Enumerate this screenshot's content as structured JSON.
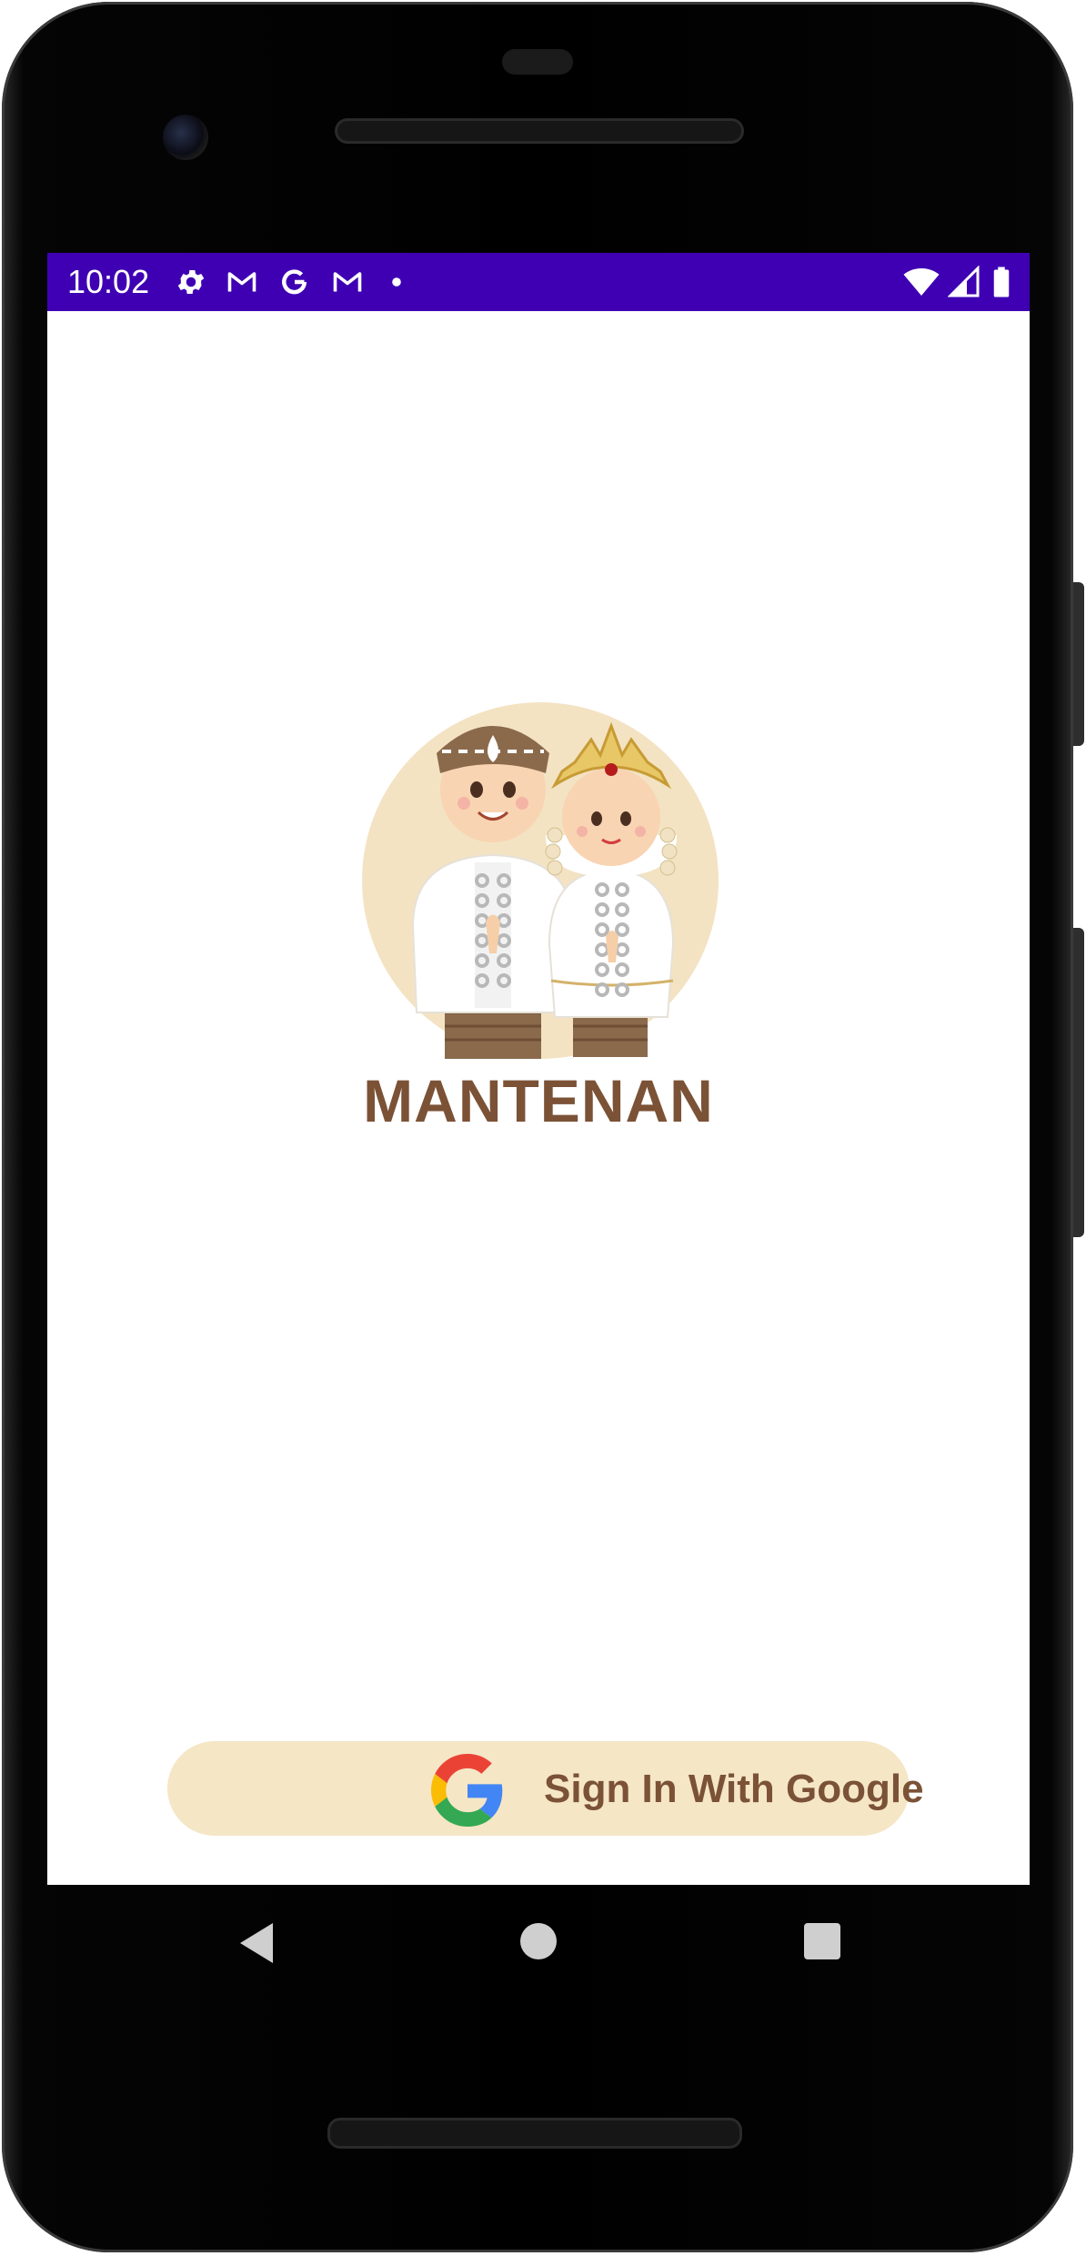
{
  "status_bar": {
    "time": "10:02",
    "background_color": "#3f00b4",
    "left_icons": [
      "settings-gear-icon",
      "gmail-icon",
      "google-g-icon",
      "gmail-icon",
      "notification-dot-icon"
    ],
    "right_icons": [
      "wifi-icon",
      "cell-signal-icon",
      "battery-icon"
    ]
  },
  "app": {
    "title": "MANTENAN",
    "brand_color": "#7b5236",
    "accent_color": "#f5e6c6",
    "logo_icon": "bride-and-groom-logo"
  },
  "sign_in": {
    "label": "Sign In With Google",
    "icon": "google-g-icon"
  },
  "nav_bar": {
    "buttons": [
      "back-icon",
      "home-icon",
      "recents-icon"
    ]
  }
}
